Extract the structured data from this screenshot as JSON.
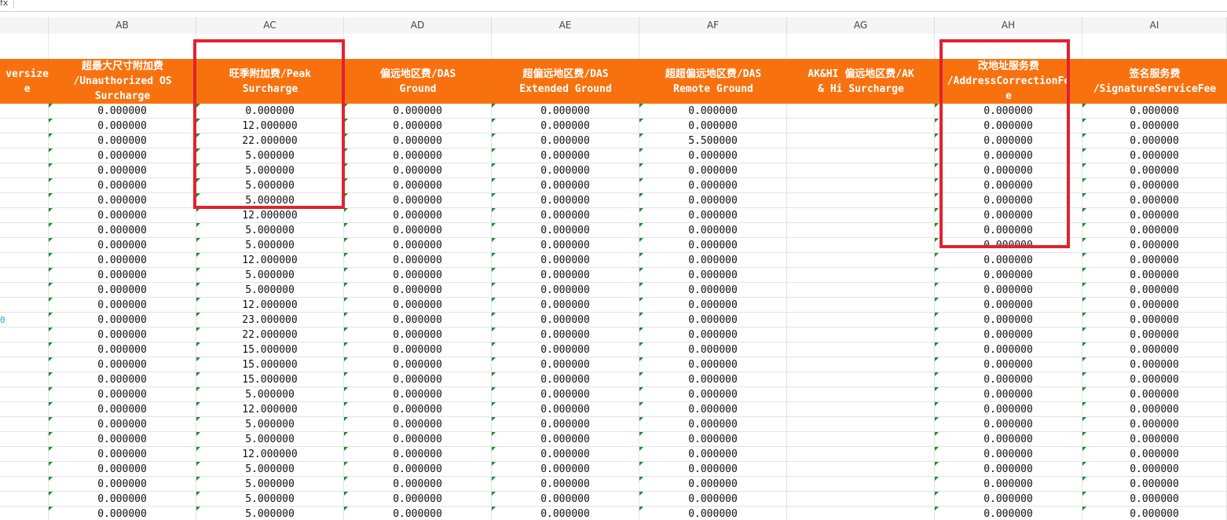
{
  "formula_bar": {
    "fx_label": "fx"
  },
  "column_letters": [
    "",
    "AB",
    "AC",
    "AD",
    "AE",
    "AF",
    "AG",
    "AH",
    "AI"
  ],
  "header_row": [
    "versize\ne",
    "超最大尺寸附加费\n/Unauthorized OS\nSurcharge",
    "旺季附加费/Peak\nSurcharge",
    "偏远地区费/DAS\nGround",
    "超偏远地区费/DAS\nExtended Ground",
    "超超偏远地区费/DAS\nRemote Ground",
    "AK&HI 偏远地区费/AK\n& Hi Surcharge",
    "改地址服务费\n/AddressCorrectionFe\ne",
    "签名服务费\n/SignatureServiceFee"
  ],
  "rows": [
    [
      "",
      "0.000000",
      "0.000000",
      "0.000000",
      "0.000000",
      "0.000000",
      "",
      "0.000000",
      "0.000000"
    ],
    [
      "",
      "0.000000",
      "12.000000",
      "0.000000",
      "0.000000",
      "0.000000",
      "",
      "0.000000",
      "0.000000"
    ],
    [
      "",
      "0.000000",
      "22.000000",
      "0.000000",
      "0.000000",
      "5.500000",
      "",
      "0.000000",
      "0.000000"
    ],
    [
      "",
      "0.000000",
      "5.000000",
      "0.000000",
      "0.000000",
      "0.000000",
      "",
      "0.000000",
      "0.000000"
    ],
    [
      "",
      "0.000000",
      "5.000000",
      "0.000000",
      "0.000000",
      "0.000000",
      "",
      "0.000000",
      "0.000000"
    ],
    [
      "",
      "0.000000",
      "5.000000",
      "0.000000",
      "0.000000",
      "0.000000",
      "",
      "0.000000",
      "0.000000"
    ],
    [
      "",
      "0.000000",
      "5.000000",
      "0.000000",
      "0.000000",
      "0.000000",
      "",
      "0.000000",
      "0.000000"
    ],
    [
      "",
      "0.000000",
      "12.000000",
      "0.000000",
      "0.000000",
      "0.000000",
      "",
      "0.000000",
      "0.000000"
    ],
    [
      "",
      "0.000000",
      "5.000000",
      "0.000000",
      "0.000000",
      "0.000000",
      "",
      "0.000000",
      "0.000000"
    ],
    [
      "",
      "0.000000",
      "5.000000",
      "0.000000",
      "0.000000",
      "0.000000",
      "",
      "0.000000",
      "0.000000"
    ],
    [
      "",
      "0.000000",
      "12.000000",
      "0.000000",
      "0.000000",
      "0.000000",
      "",
      "0.000000",
      "0.000000"
    ],
    [
      "",
      "0.000000",
      "5.000000",
      "0.000000",
      "0.000000",
      "0.000000",
      "",
      "0.000000",
      "0.000000"
    ],
    [
      "",
      "0.000000",
      "5.000000",
      "0.000000",
      "0.000000",
      "0.000000",
      "",
      "0.000000",
      "0.000000"
    ],
    [
      "",
      "0.000000",
      "12.000000",
      "0.000000",
      "0.000000",
      "0.000000",
      "",
      "0.000000",
      "0.000000"
    ],
    [
      "0",
      "0.000000",
      "23.000000",
      "0.000000",
      "0.000000",
      "0.000000",
      "",
      "0.000000",
      "0.000000"
    ],
    [
      "",
      "0.000000",
      "22.000000",
      "0.000000",
      "0.000000",
      "0.000000",
      "",
      "0.000000",
      "0.000000"
    ],
    [
      "",
      "0.000000",
      "15.000000",
      "0.000000",
      "0.000000",
      "0.000000",
      "",
      "0.000000",
      "0.000000"
    ],
    [
      "",
      "0.000000",
      "15.000000",
      "0.000000",
      "0.000000",
      "0.000000",
      "",
      "0.000000",
      "0.000000"
    ],
    [
      "",
      "0.000000",
      "15.000000",
      "0.000000",
      "0.000000",
      "0.000000",
      "",
      "0.000000",
      "0.000000"
    ],
    [
      "",
      "0.000000",
      "5.000000",
      "0.000000",
      "0.000000",
      "0.000000",
      "",
      "0.000000",
      "0.000000"
    ],
    [
      "",
      "0.000000",
      "12.000000",
      "0.000000",
      "0.000000",
      "0.000000",
      "",
      "0.000000",
      "0.000000"
    ],
    [
      "",
      "0.000000",
      "5.000000",
      "0.000000",
      "0.000000",
      "0.000000",
      "",
      "0.000000",
      "0.000000"
    ],
    [
      "",
      "0.000000",
      "5.000000",
      "0.000000",
      "0.000000",
      "0.000000",
      "",
      "0.000000",
      "0.000000"
    ],
    [
      "",
      "0.000000",
      "12.000000",
      "0.000000",
      "0.000000",
      "0.000000",
      "",
      "0.000000",
      "0.000000"
    ],
    [
      "",
      "0.000000",
      "5.000000",
      "0.000000",
      "0.000000",
      "0.000000",
      "",
      "0.000000",
      "0.000000"
    ],
    [
      "",
      "0.000000",
      "5.000000",
      "0.000000",
      "0.000000",
      "0.000000",
      "",
      "0.000000",
      "0.000000"
    ],
    [
      "",
      "0.000000",
      "5.000000",
      "0.000000",
      "0.000000",
      "0.000000",
      "",
      "0.000000",
      "0.000000"
    ],
    [
      "",
      "0.000000",
      "5.000000",
      "0.000000",
      "0.000000",
      "0.000000",
      "",
      "0.000000",
      "0.000000"
    ]
  ],
  "colors": {
    "header_bg": "#f7720f",
    "highlight": "#e2222f",
    "error_triangle": "#1d8a2a"
  }
}
